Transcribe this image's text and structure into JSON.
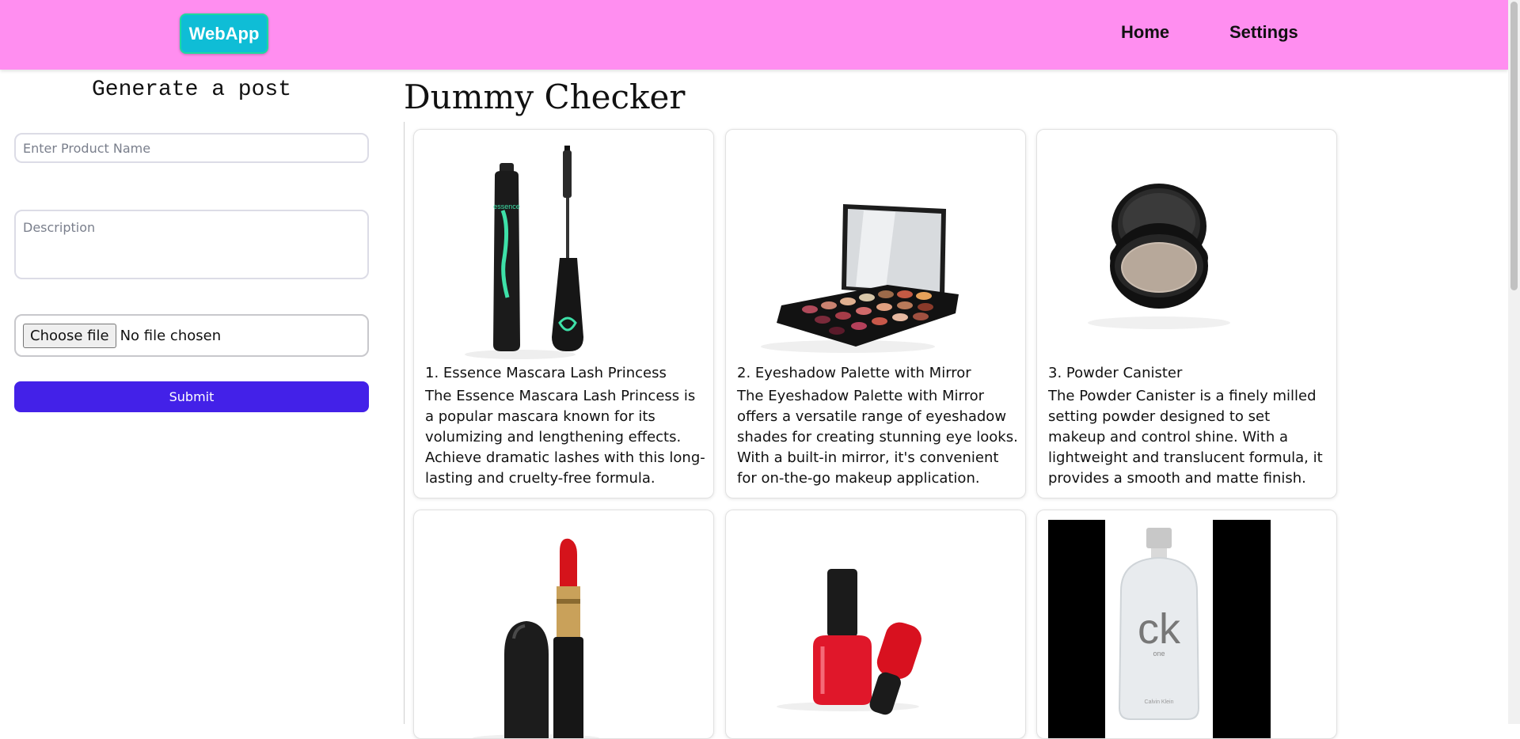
{
  "header": {
    "brand": "WebApp",
    "nav": [
      "Home",
      "Settings"
    ]
  },
  "form": {
    "title": "Generate a post",
    "product_placeholder": "Enter Product Name",
    "description_placeholder": "Description",
    "file_button": "Choose file",
    "file_status": "No file chosen",
    "submit": "Submit"
  },
  "main": {
    "title": "Dummy Checker",
    "products": [
      {
        "title": "1. Essence Mascara Lash Princess",
        "description": "The Essence Mascara Lash Princess is a popular mascara known for its volumizing and lengthening effects. Achieve dramatic lashes with this long-lasting and cruelty-free formula.",
        "image_icon": "mascara-icon",
        "brand_text": "essence"
      },
      {
        "title": "2. Eyeshadow Palette with Mirror",
        "description": "The Eyeshadow Palette with Mirror offers a versatile range of eyeshadow shades for creating stunning eye looks. With a built-in mirror, it's convenient for on-the-go makeup application.",
        "image_icon": "eyeshadow-palette-icon"
      },
      {
        "title": "3. Powder Canister",
        "description": "The Powder Canister is a finely milled setting powder designed to set makeup and control shine. With a lightweight and translucent formula, it provides a smooth and matte finish.",
        "image_icon": "powder-canister-icon"
      },
      {
        "title": "",
        "description": "",
        "image_icon": "lipstick-icon"
      },
      {
        "title": "",
        "description": "",
        "image_icon": "nail-polish-icon"
      },
      {
        "title": "",
        "description": "",
        "image_icon": "perfume-bottle-icon",
        "brand_text": "ck",
        "brand_sub": "one",
        "brand_maker": "Calvin Klein"
      }
    ]
  },
  "colors": {
    "header_bg": "#ff8ef0",
    "brand_bg": "#0fbdd6",
    "submit_bg": "#4321e8"
  }
}
